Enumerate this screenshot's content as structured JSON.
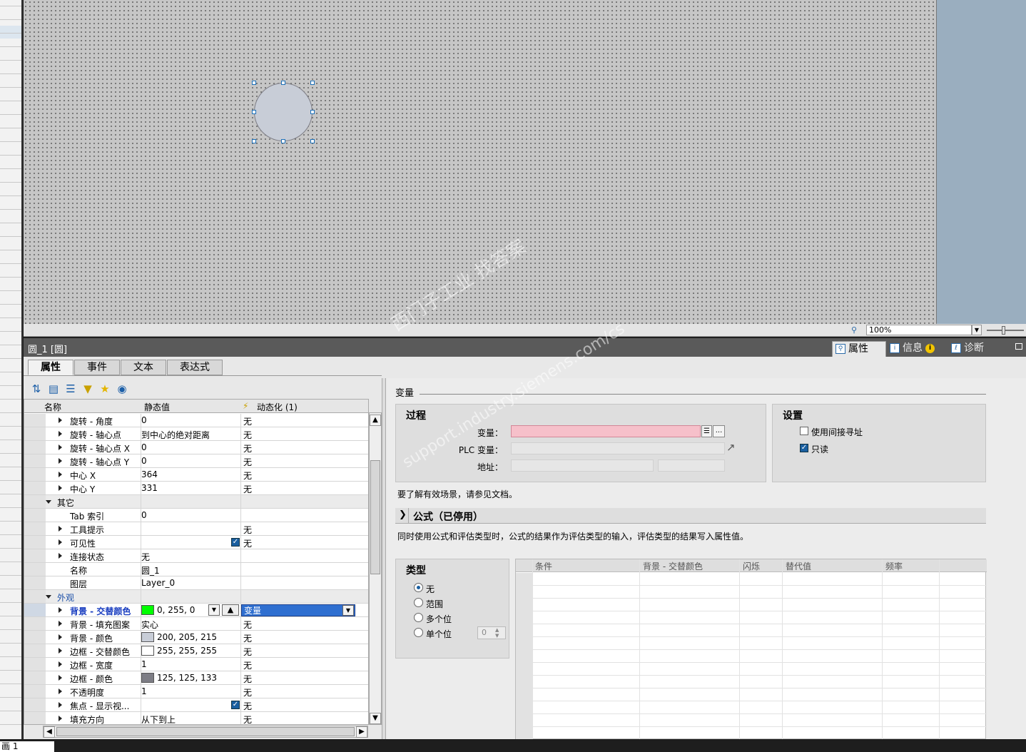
{
  "canvas": {
    "zoom": "100%"
  },
  "panel": {
    "object_title": "圆_1 [圆]",
    "top_tabs": {
      "properties": "属性",
      "info": "信息",
      "diagnostics": "诊断"
    },
    "sub_tabs": {
      "properties": "属性",
      "events": "事件",
      "text": "文本",
      "expressions": "表达式"
    }
  },
  "grid": {
    "headers": {
      "name": "名称",
      "static": "静态值",
      "dynamic": "动态化 (1)"
    },
    "rows": [
      {
        "name": "旋转 - 角度",
        "static": "0",
        "dynamic": "无"
      },
      {
        "name": "旋转 - 轴心点",
        "static": "到中心的绝对距离",
        "dynamic": "无"
      },
      {
        "name": "旋转 - 轴心点 X",
        "static": "0",
        "dynamic": "无"
      },
      {
        "name": "旋转 - 轴心点 Y",
        "static": "0",
        "dynamic": "无"
      },
      {
        "name": "中心 X",
        "static": "364",
        "dynamic": "无"
      },
      {
        "name": "中心 Y",
        "static": "331",
        "dynamic": "无"
      },
      {
        "name": "其它",
        "static": "",
        "dynamic": ""
      },
      {
        "name": "Tab 索引",
        "static": "0",
        "dynamic": ""
      },
      {
        "name": "工具提示",
        "static": "",
        "dynamic": "无"
      },
      {
        "name": "可见性",
        "static": "",
        "dynamic": "无"
      },
      {
        "name": "连接状态",
        "static": "无",
        "dynamic": ""
      },
      {
        "name": "名称",
        "static": "圆_1",
        "dynamic": ""
      },
      {
        "name": "图层",
        "static": "Layer_0",
        "dynamic": ""
      },
      {
        "name": "外观",
        "static": "",
        "dynamic": ""
      },
      {
        "name": "背景 - 交替颜色",
        "static": "0, 255, 0",
        "dynamic": "变量"
      },
      {
        "name": "背景 - 填充图案",
        "static": "实心",
        "dynamic": "无"
      },
      {
        "name": "背景 - 颜色",
        "static": "200, 205, 215",
        "dynamic": "无"
      },
      {
        "name": "边框 - 交替颜色",
        "static": "255, 255, 255",
        "dynamic": "无"
      },
      {
        "name": "边框 - 宽度",
        "static": "1",
        "dynamic": "无"
      },
      {
        "name": "边框 - 颜色",
        "static": "125, 125, 133",
        "dynamic": "无"
      },
      {
        "name": "不透明度",
        "static": "1",
        "dynamic": "无"
      },
      {
        "name": "焦点 - 显示视...",
        "static": "",
        "dynamic": "无"
      },
      {
        "name": "填充方向",
        "static": "从下到上",
        "dynamic": "无"
      }
    ],
    "swatches": {
      "alt_bg": "#00ff00",
      "bg": "#c8cdd7",
      "alt_border": "#ffffff",
      "border": "#7d7d85"
    }
  },
  "right": {
    "section_title": "变量",
    "process": {
      "title": "过程",
      "tag_label": "变量：",
      "plc_tag_label": "PLC 变量：",
      "address_label": "地址："
    },
    "settings": {
      "title": "设置",
      "indirect_label": "使用间接寻址",
      "readonly_label": "只读"
    },
    "hint": "要了解有效场景，请参见文档。",
    "formula_title": "公式（已停用）",
    "formula_desc": "同时使用公式和评估类型时，公式的结果作为评估类型的输入，评估类型的结果写入属性值。",
    "type": {
      "title": "类型",
      "options": [
        "无",
        "范围",
        "多个位",
        "单个位"
      ],
      "bit_value": "0"
    },
    "table_headers": [
      "条件",
      "背景 - 交替颜色",
      "闪烁",
      "替代值",
      "频率"
    ]
  },
  "bottom": {
    "tab": "画 1"
  },
  "watermark": {
    "line1": "西门子工业 找答案",
    "line2": "support.industry.siemens.com/cs"
  }
}
